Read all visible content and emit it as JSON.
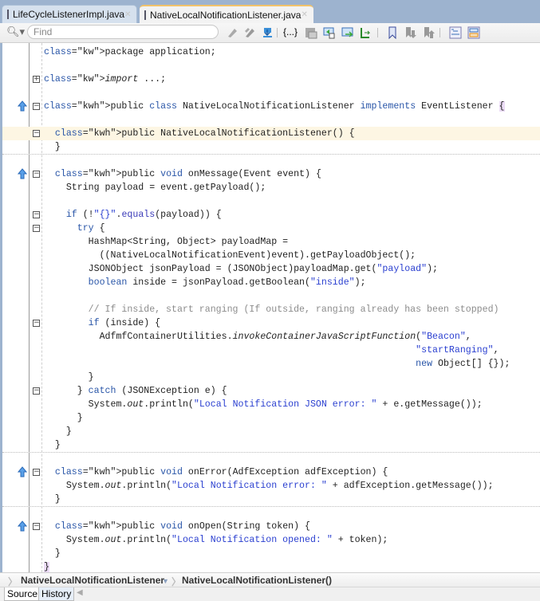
{
  "tabs": [
    {
      "label": "LifeCycleListenerImpl.java",
      "active": false
    },
    {
      "label": "NativeLocalNotificationListener.java",
      "active": true
    }
  ],
  "toolbar": {
    "search_placeholder": "Find",
    "icons": [
      "previous-occurrence-icon",
      "next-occurrence-icon",
      "toggle-highlight-icon",
      "match-brace-icon",
      "toggle-line-numbers-icon",
      "shift-left-icon",
      "shift-right-icon",
      "format-icon",
      "toggle-bookmark-icon",
      "next-bookmark-icon",
      "previous-bookmark-icon",
      "comment-icon",
      "uncomment-icon"
    ]
  },
  "code": {
    "lines": [
      {
        "t": "package application;",
        "fold": null
      },
      {
        "t": "",
        "fold": null
      },
      {
        "t": "import ...;",
        "fold": "plus"
      },
      {
        "t": "",
        "fold": null
      },
      {
        "t": "public class NativeLocalNotificationListener implements EventListener {",
        "fold": "minus",
        "up": true
      },
      {
        "t": "",
        "fold": null
      },
      {
        "t": "  public NativeLocalNotificationListener() {",
        "fold": "minus"
      },
      {
        "t": "  }",
        "fold": null
      },
      {
        "t": "",
        "fold": null
      },
      {
        "t": "  public void onMessage(Event event) {",
        "fold": "minus",
        "up": true
      },
      {
        "t": "    String payload = event.getPayload();",
        "fold": null
      },
      {
        "t": "",
        "fold": null
      },
      {
        "t": "    if (!\"{}\".equals(payload)) {",
        "fold": "minus"
      },
      {
        "t": "      try {",
        "fold": "minus"
      },
      {
        "t": "        HashMap<String, Object> payloadMap =",
        "fold": null
      },
      {
        "t": "          ((NativeLocalNotificationEvent)event).getPayloadObject();",
        "fold": null
      },
      {
        "t": "        JSONObject jsonPayload = (JSONObject)payloadMap.get(\"payload\");",
        "fold": null
      },
      {
        "t": "        boolean inside = jsonPayload.getBoolean(\"inside\");",
        "fold": null
      },
      {
        "t": "",
        "fold": null
      },
      {
        "t": "        // If inside, start ranging (If outside, ranging already has been stopped)",
        "fold": null
      },
      {
        "t": "        if (inside) {",
        "fold": "minus"
      },
      {
        "t": "          AdfmfContainerUtilities.invokeContainerJavaScriptFunction(\"Beacon\",",
        "fold": null
      },
      {
        "t": "                                                                   \"startRanging\",",
        "fold": null
      },
      {
        "t": "                                                                   new Object[] {});",
        "fold": null
      },
      {
        "t": "        }",
        "fold": null
      },
      {
        "t": "      } catch (JSONException e) {",
        "fold": "minus"
      },
      {
        "t": "        System.out.println(\"Local Notification JSON error: \" + e.getMessage());",
        "fold": null
      },
      {
        "t": "      }",
        "fold": null
      },
      {
        "t": "    }",
        "fold": null
      },
      {
        "t": "  }",
        "fold": null
      },
      {
        "t": "",
        "fold": null
      },
      {
        "t": "  public void onError(AdfException adfException) {",
        "fold": "minus",
        "up": true
      },
      {
        "t": "    System.out.println(\"Local Notification error: \" + adfException.getMessage());",
        "fold": null
      },
      {
        "t": "  }",
        "fold": null
      },
      {
        "t": "",
        "fold": null
      },
      {
        "t": "  public void onOpen(String token) {",
        "fold": "minus",
        "up": true
      },
      {
        "t": "    System.out.println(\"Local Notification opened: \" + token);",
        "fold": null
      },
      {
        "t": "  }",
        "fold": null
      },
      {
        "t": "}",
        "fold": null
      }
    ]
  },
  "breadcrumb": {
    "items": [
      "NativeLocalNotificationListener",
      "NativeLocalNotificationListener()"
    ]
  },
  "bottom_tabs": {
    "source": "Source",
    "history": "History"
  }
}
